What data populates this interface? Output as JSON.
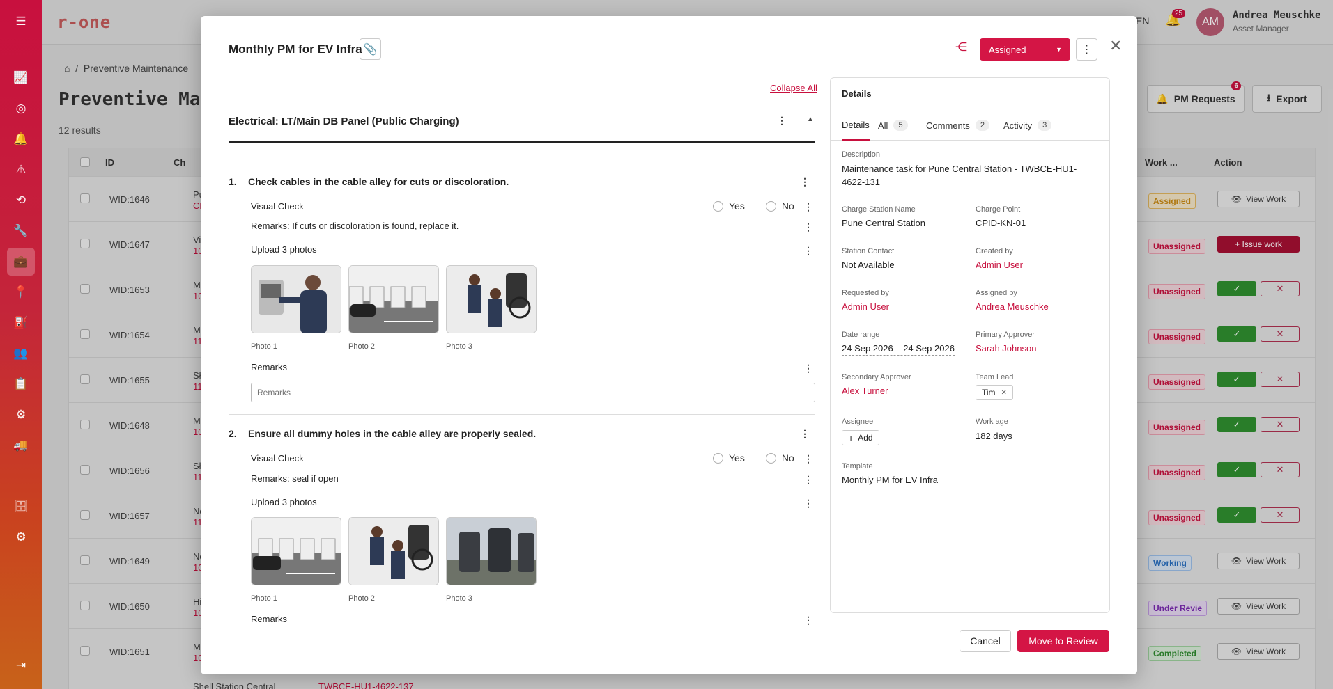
{
  "app": {
    "logo": "r-one",
    "language": "EN",
    "notifications": "25",
    "user_initials": "AM",
    "user_name": "Andrea Meuschke",
    "user_role": "Asset Manager"
  },
  "background": {
    "breadcrumb": "Preventive Maintenance",
    "title": "Preventive Main",
    "results": "12 results",
    "pm_requests_label": "PM Requests",
    "pm_requests_badge": "6",
    "export_label": "Export",
    "columns": {
      "id": "ID",
      "ch": "Ch",
      "work": "Work ...",
      "action": "Action"
    },
    "rows": [
      {
        "id": "WID:1646",
        "c1": "Pu",
        "c2": "CF",
        "status": "Assigned",
        "kind": "assigned",
        "action": "view"
      },
      {
        "id": "WID:1647",
        "c1": "Vi",
        "c2": "10",
        "status": "Unassigned",
        "kind": "unassigned",
        "action": "issue"
      },
      {
        "id": "WID:1653",
        "c1": "M",
        "c2": "10",
        "status": "Unassigned",
        "kind": "unassigned",
        "action": "approve"
      },
      {
        "id": "WID:1654",
        "c1": "M",
        "c2": "11",
        "status": "Unassigned",
        "kind": "unassigned",
        "action": "approve"
      },
      {
        "id": "WID:1655",
        "c1": "Sł",
        "c2": "11",
        "status": "Unassigned",
        "kind": "unassigned",
        "action": "approve"
      },
      {
        "id": "WID:1648",
        "c1": "M",
        "c2": "10",
        "status": "Unassigned",
        "kind": "unassigned",
        "action": "approve"
      },
      {
        "id": "WID:1656",
        "c1": "Sł",
        "c2": "11",
        "status": "Unassigned",
        "kind": "unassigned",
        "action": "approve"
      },
      {
        "id": "WID:1657",
        "c1": "Ne",
        "c2": "11",
        "status": "Unassigned",
        "kind": "unassigned",
        "action": "approve"
      },
      {
        "id": "WID:1649",
        "c1": "Ne",
        "c2": "10",
        "status": "Working",
        "kind": "working",
        "action": "view"
      },
      {
        "id": "WID:1650",
        "c1": "Hi",
        "c2": "10",
        "status": "Under Revie",
        "kind": "review",
        "action": "view"
      },
      {
        "id": "WID:1651",
        "c1": "M",
        "c2": "10",
        "status": "Completed",
        "kind": "completed",
        "action": "view"
      }
    ],
    "last_row_station": "Shell Station Central",
    "last_row_id": "TWBCE-HU1-4622-137",
    "view_work_label": "View Work",
    "issue_work_label": "+ Issue work"
  },
  "modal": {
    "title": "Monthly PM for EV Infra",
    "status": "Assigned",
    "collapse_all": "Collapse All",
    "section_title": "Electrical: LT/Main DB Panel (Public Charging)",
    "questions": [
      {
        "num": "1.",
        "text": "Check cables in the cable alley for cuts or discoloration.",
        "visual_check": "Visual Check",
        "yes": "Yes",
        "no": "No",
        "remarks_note": "Remarks: If cuts or discoloration is found, replace it.",
        "upload": "Upload 3 photos",
        "photos": [
          "Photo 1",
          "Photo 2",
          "Photo 3"
        ],
        "remarks_label": "Remarks",
        "remarks_placeholder": "Remarks"
      },
      {
        "num": "2.",
        "text": "Ensure all dummy holes in the cable alley are properly sealed.",
        "visual_check": "Visual Check",
        "yes": "Yes",
        "no": "No",
        "remarks_note": "Remarks: seal if open",
        "upload": "Upload 3 photos",
        "photos": [
          "Photo 1",
          "Photo 2",
          "Photo 3"
        ],
        "remarks_label": "Remarks"
      }
    ],
    "details": {
      "title": "Details",
      "tabs": [
        {
          "label": "Details"
        },
        {
          "label": "All",
          "count": "5"
        },
        {
          "label": "Comments",
          "count": "2"
        },
        {
          "label": "Activity",
          "count": "3"
        }
      ],
      "description_label": "Description",
      "description": "Maintenance task for Pune Central Station - TWBCE-HU1-4622-131",
      "charge_station_label": "Charge Station Name",
      "charge_station": "Pune Central Station",
      "charge_point_label": "Charge Point",
      "charge_point": "CPID-KN-01",
      "station_contact_label": "Station Contact",
      "station_contact": "Not Available",
      "created_by_label": "Created by",
      "created_by": "Admin User",
      "requested_by_label": "Requested by",
      "requested_by": "Admin User",
      "assigned_by_label": "Assigned by",
      "assigned_by": "Andrea Meuschke",
      "date_range_label": "Date range",
      "date_range": "24 Sep 2026 – 24 Sep 2026",
      "primary_approver_label": "Primary Approver",
      "primary_approver": "Sarah Johnson",
      "secondary_approver_label": "Secondary Approver",
      "secondary_approver": "Alex Turner",
      "team_lead_label": "Team Lead",
      "team_lead": "Tim",
      "assignee_label": "Assignee",
      "add_label": "Add",
      "work_age_label": "Work age",
      "work_age": "182 days",
      "template_label": "Template",
      "template": "Monthly PM for EV Infra"
    },
    "cancel_label": "Cancel",
    "review_label": "Move to Review"
  }
}
